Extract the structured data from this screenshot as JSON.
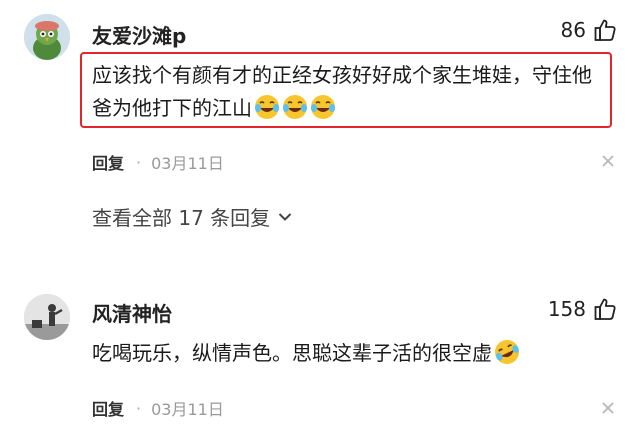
{
  "comments": [
    {
      "username": "友爱沙滩p",
      "likes": "86",
      "text": "应该找个有颜有才的正经女孩好好成个家生堆娃，守住他爸为他打下的江山",
      "emoji_count": 3,
      "reply_label": "回复",
      "separator": "·",
      "date": "03月11日",
      "view_replies_label": "查看全部 17 条回复"
    },
    {
      "username": "风清神怡",
      "likes": "158",
      "text": "吃喝玩乐，纵情声色。思聪这辈子活的很空虚",
      "emoji_count": 1,
      "reply_label": "回复",
      "separator": "·",
      "date": "03月11日"
    }
  ],
  "icons": {
    "like": "thumbs-up-outline-icon",
    "close": "close-x-icon",
    "expand": "chevron-down-icon",
    "emoji_1": "laughing-crying-emoji",
    "emoji_2": "rolling-laughing-emoji"
  },
  "colors": {
    "highlight_border": "#e3252e",
    "meta_text": "#9a9a9a"
  }
}
